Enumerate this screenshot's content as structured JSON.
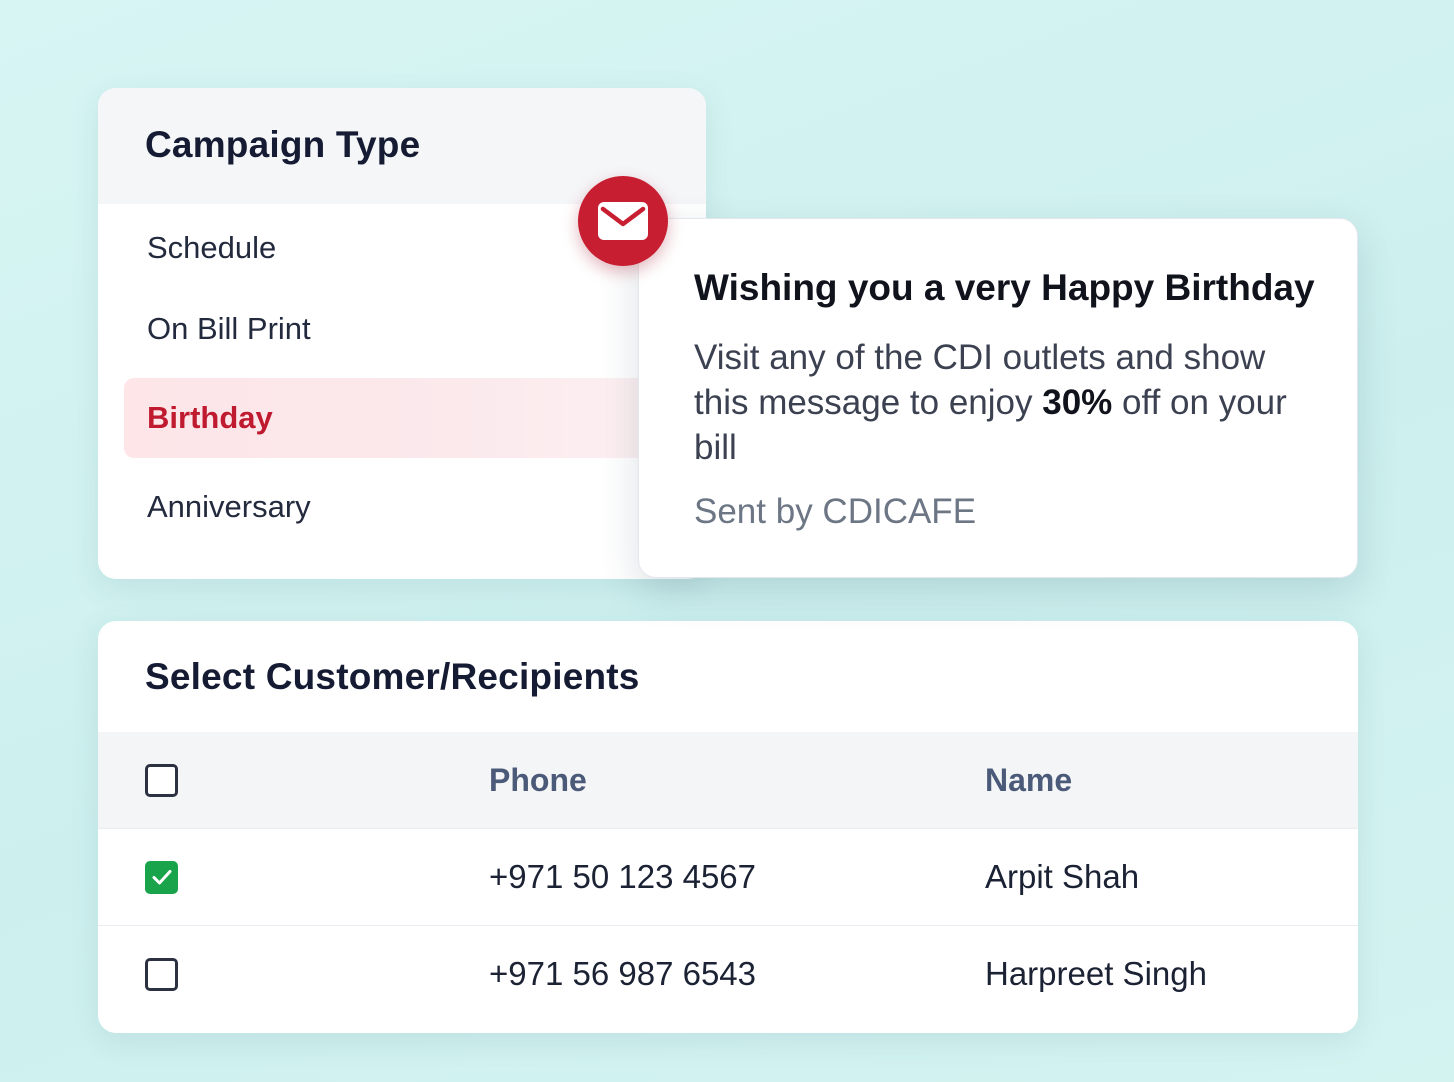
{
  "campaign": {
    "title": "Campaign Type",
    "items": [
      {
        "label": "Schedule",
        "active": false
      },
      {
        "label": "On Bill Print",
        "active": false
      },
      {
        "label": "Birthday",
        "active": true
      },
      {
        "label": "Anniversary",
        "active": false
      }
    ]
  },
  "message": {
    "icon": "mail-icon",
    "title": "Wishing you a very Happy Birthday",
    "body_before": "Visit any of the CDI outlets and show this message to enjoy ",
    "body_highlight": "30%",
    "body_after": " off on your bill",
    "sender": "Sent by CDICAFE"
  },
  "recipients": {
    "title": "Select Customer/Recipients",
    "columns": {
      "phone": "Phone",
      "name": "Name"
    },
    "select_all_checked": false,
    "rows": [
      {
        "phone": "+971 50 123 4567",
        "name": "Arpit Shah",
        "checked": true
      },
      {
        "phone": "+971 56 987 6543",
        "name": "Harpreet Singh",
        "checked": false
      }
    ]
  },
  "colors": {
    "accent": "#c81e32",
    "active_item_bg": "#fde5e8",
    "check_green": "#19a34a",
    "background": "#d3f3f1"
  }
}
